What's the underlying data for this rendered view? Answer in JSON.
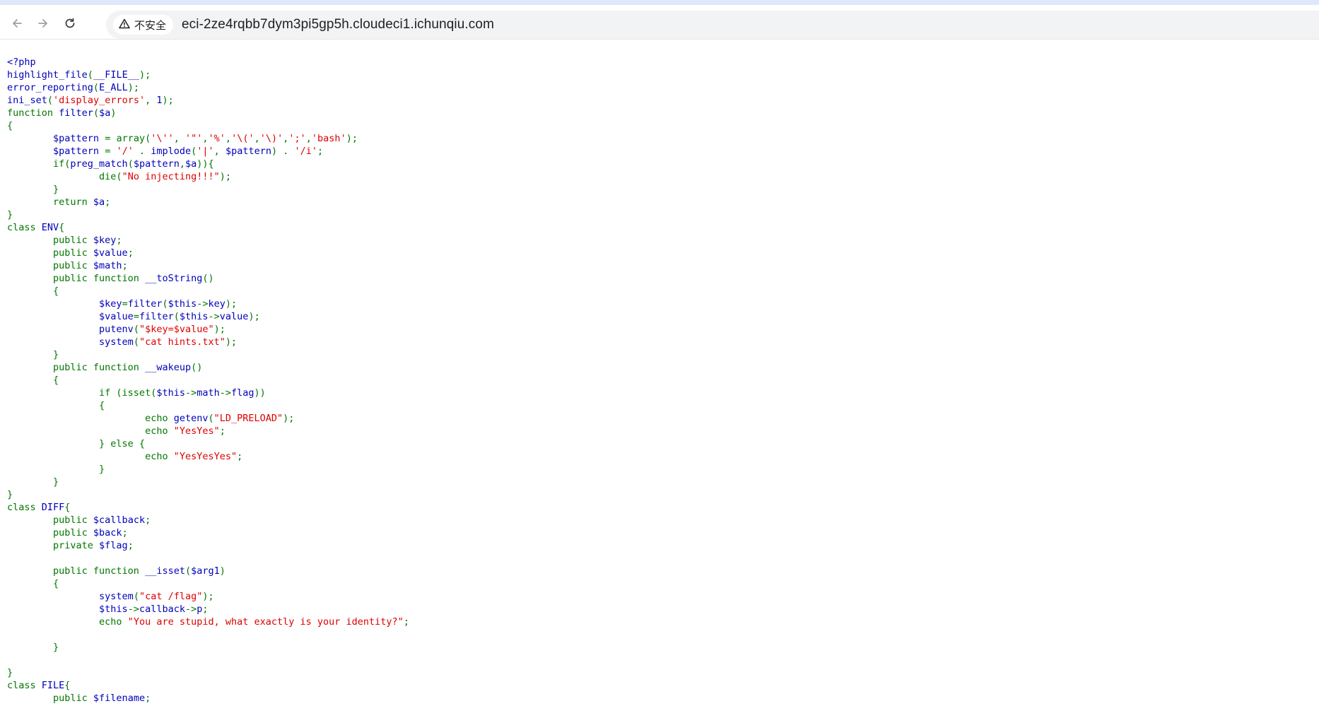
{
  "browser": {
    "security_label": "不安全",
    "url": "eci-2ze4rqbb7dym3pi5gp5h.cloudeci1.ichunqiu.com",
    "icons": [
      "back-arrow-icon",
      "forward-arrow-icon",
      "reload-icon",
      "warning-triangle-icon"
    ]
  },
  "colors": {
    "default": "#0000BB",
    "keyword": "#007700",
    "string": "#DD0000",
    "html": "#000000"
  },
  "code": {
    "lines": [
      [
        [
          "d",
          "<?php"
        ]
      ],
      [
        [
          "d",
          "highlight_file"
        ],
        [
          "k",
          "("
        ],
        [
          "d",
          "__FILE__"
        ],
        [
          "k",
          ");"
        ]
      ],
      [
        [
          "d",
          "error_reporting"
        ],
        [
          "k",
          "("
        ],
        [
          "d",
          "E_ALL"
        ],
        [
          "k",
          ");"
        ]
      ],
      [
        [
          "d",
          "ini_set"
        ],
        [
          "k",
          "("
        ],
        [
          "s",
          "'display_errors'"
        ],
        [
          "k",
          ", "
        ],
        [
          "d",
          "1"
        ],
        [
          "k",
          ");"
        ]
      ],
      [
        [
          "k",
          "function "
        ],
        [
          "d",
          "filter"
        ],
        [
          "k",
          "("
        ],
        [
          "d",
          "$a"
        ],
        [
          "k",
          ")"
        ]
      ],
      [
        [
          "k",
          "{"
        ]
      ],
      [
        [
          "k",
          "        "
        ],
        [
          "d",
          "$pattern "
        ],
        [
          "k",
          "= array("
        ],
        [
          "s",
          "'\\''"
        ],
        [
          "k",
          ", "
        ],
        [
          "s",
          "'\"'"
        ],
        [
          "k",
          ","
        ],
        [
          "s",
          "'%'"
        ],
        [
          "k",
          ","
        ],
        [
          "s",
          "'\\('"
        ],
        [
          "k",
          ","
        ],
        [
          "s",
          "'\\)'"
        ],
        [
          "k",
          ","
        ],
        [
          "s",
          "';'"
        ],
        [
          "k",
          ","
        ],
        [
          "s",
          "'bash'"
        ],
        [
          "k",
          ");"
        ]
      ],
      [
        [
          "k",
          "        "
        ],
        [
          "d",
          "$pattern "
        ],
        [
          "k",
          "= "
        ],
        [
          "s",
          "'/'"
        ],
        [
          "k",
          " . "
        ],
        [
          "d",
          "implode"
        ],
        [
          "k",
          "("
        ],
        [
          "s",
          "'|'"
        ],
        [
          "k",
          ", "
        ],
        [
          "d",
          "$pattern"
        ],
        [
          "k",
          ") . "
        ],
        [
          "s",
          "'/i'"
        ],
        [
          "k",
          ";"
        ]
      ],
      [
        [
          "k",
          "        if("
        ],
        [
          "d",
          "preg_match"
        ],
        [
          "k",
          "("
        ],
        [
          "d",
          "$pattern"
        ],
        [
          "k",
          ","
        ],
        [
          "d",
          "$a"
        ],
        [
          "k",
          ")){"
        ]
      ],
      [
        [
          "k",
          "                die("
        ],
        [
          "s",
          "\"No injecting!!!\""
        ],
        [
          "k",
          ");"
        ]
      ],
      [
        [
          "k",
          "        }"
        ]
      ],
      [
        [
          "k",
          "        return "
        ],
        [
          "d",
          "$a"
        ],
        [
          "k",
          ";"
        ]
      ],
      [
        [
          "k",
          "}"
        ]
      ],
      [
        [
          "k",
          "class "
        ],
        [
          "d",
          "ENV"
        ],
        [
          "k",
          "{"
        ]
      ],
      [
        [
          "k",
          "        public "
        ],
        [
          "d",
          "$key"
        ],
        [
          "k",
          ";"
        ]
      ],
      [
        [
          "k",
          "        public "
        ],
        [
          "d",
          "$value"
        ],
        [
          "k",
          ";"
        ]
      ],
      [
        [
          "k",
          "        public "
        ],
        [
          "d",
          "$math"
        ],
        [
          "k",
          ";"
        ]
      ],
      [
        [
          "k",
          "        public function "
        ],
        [
          "d",
          "__toString"
        ],
        [
          "k",
          "()"
        ]
      ],
      [
        [
          "k",
          "        {"
        ]
      ],
      [
        [
          "k",
          "                "
        ],
        [
          "d",
          "$key"
        ],
        [
          "k",
          "="
        ],
        [
          "d",
          "filter"
        ],
        [
          "k",
          "("
        ],
        [
          "d",
          "$this"
        ],
        [
          "k",
          "->"
        ],
        [
          "d",
          "key"
        ],
        [
          "k",
          ");"
        ]
      ],
      [
        [
          "k",
          "                "
        ],
        [
          "d",
          "$value"
        ],
        [
          "k",
          "="
        ],
        [
          "d",
          "filter"
        ],
        [
          "k",
          "("
        ],
        [
          "d",
          "$this"
        ],
        [
          "k",
          "->"
        ],
        [
          "d",
          "value"
        ],
        [
          "k",
          ");"
        ]
      ],
      [
        [
          "k",
          "                "
        ],
        [
          "d",
          "putenv"
        ],
        [
          "k",
          "("
        ],
        [
          "s",
          "\"$key=$value\""
        ],
        [
          "k",
          ");"
        ]
      ],
      [
        [
          "k",
          "                "
        ],
        [
          "d",
          "system"
        ],
        [
          "k",
          "("
        ],
        [
          "s",
          "\"cat hints.txt\""
        ],
        [
          "k",
          ");"
        ]
      ],
      [
        [
          "k",
          "        }"
        ]
      ],
      [
        [
          "k",
          "        public function "
        ],
        [
          "d",
          "__wakeup"
        ],
        [
          "k",
          "()"
        ]
      ],
      [
        [
          "k",
          "        {"
        ]
      ],
      [
        [
          "k",
          "                if (isset("
        ],
        [
          "d",
          "$this"
        ],
        [
          "k",
          "->"
        ],
        [
          "d",
          "math"
        ],
        [
          "k",
          "->"
        ],
        [
          "d",
          "flag"
        ],
        [
          "k",
          "))"
        ]
      ],
      [
        [
          "k",
          "                {"
        ]
      ],
      [
        [
          "k",
          "                        echo "
        ],
        [
          "d",
          "getenv"
        ],
        [
          "k",
          "("
        ],
        [
          "s",
          "\"LD_PRELOAD\""
        ],
        [
          "k",
          ");"
        ]
      ],
      [
        [
          "k",
          "                        echo "
        ],
        [
          "s",
          "\"YesYes\""
        ],
        [
          "k",
          ";"
        ]
      ],
      [
        [
          "k",
          "                } else {"
        ]
      ],
      [
        [
          "k",
          "                        echo "
        ],
        [
          "s",
          "\"YesYesYes\""
        ],
        [
          "k",
          ";"
        ]
      ],
      [
        [
          "k",
          "                }"
        ]
      ],
      [
        [
          "k",
          "        }"
        ]
      ],
      [
        [
          "k",
          "}"
        ]
      ],
      [
        [
          "k",
          "class "
        ],
        [
          "d",
          "DIFF"
        ],
        [
          "k",
          "{"
        ]
      ],
      [
        [
          "k",
          "        public "
        ],
        [
          "d",
          "$callback"
        ],
        [
          "k",
          ";"
        ]
      ],
      [
        [
          "k",
          "        public "
        ],
        [
          "d",
          "$back"
        ],
        [
          "k",
          ";"
        ]
      ],
      [
        [
          "k",
          "        private "
        ],
        [
          "d",
          "$flag"
        ],
        [
          "k",
          ";"
        ]
      ],
      [
        [
          "k",
          ""
        ]
      ],
      [
        [
          "k",
          "        public function "
        ],
        [
          "d",
          "__isset"
        ],
        [
          "k",
          "("
        ],
        [
          "d",
          "$arg1"
        ],
        [
          "k",
          ")"
        ]
      ],
      [
        [
          "k",
          "        {"
        ]
      ],
      [
        [
          "k",
          "                "
        ],
        [
          "d",
          "system"
        ],
        [
          "k",
          "("
        ],
        [
          "s",
          "\"cat /flag\""
        ],
        [
          "k",
          ");"
        ]
      ],
      [
        [
          "k",
          "                "
        ],
        [
          "d",
          "$this"
        ],
        [
          "k",
          "->"
        ],
        [
          "d",
          "callback"
        ],
        [
          "k",
          "->"
        ],
        [
          "d",
          "p"
        ],
        [
          "k",
          ";"
        ]
      ],
      [
        [
          "k",
          "                echo "
        ],
        [
          "s",
          "\"You are stupid, what exactly is your identity?\""
        ],
        [
          "k",
          ";"
        ]
      ],
      [
        [
          "k",
          ""
        ]
      ],
      [
        [
          "k",
          "        }"
        ]
      ],
      [
        [
          "k",
          ""
        ]
      ],
      [
        [
          "k",
          "}"
        ]
      ],
      [
        [
          "k",
          "class "
        ],
        [
          "d",
          "FILE"
        ],
        [
          "k",
          "{"
        ]
      ],
      [
        [
          "k",
          "        public "
        ],
        [
          "d",
          "$filename"
        ],
        [
          "k",
          ";"
        ]
      ]
    ]
  }
}
